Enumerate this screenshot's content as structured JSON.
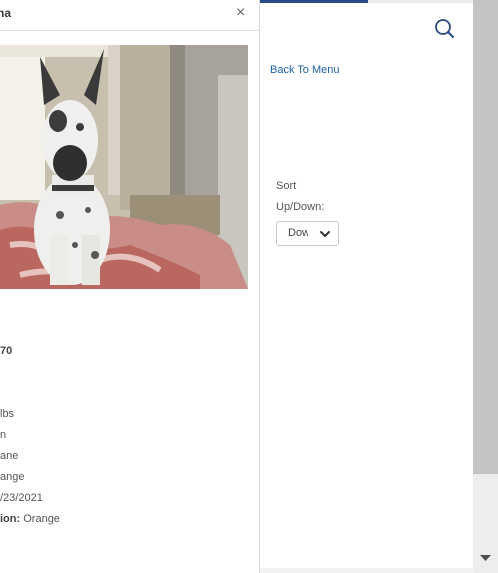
{
  "modal": {
    "title": "na",
    "close_label": "×",
    "photo_alt": "",
    "id_line": "70",
    "details": [
      {
        "label": "",
        "value": "lbs"
      },
      {
        "label": "",
        "value": "n"
      },
      {
        "label": "",
        "value": "ane"
      },
      {
        "label": "",
        "value": "ange"
      },
      {
        "label": "",
        "value": "/23/2021"
      },
      {
        "label": "ion:",
        "value": "Orange"
      }
    ]
  },
  "nav": {
    "back_label": "Back To Menu",
    "search_icon": "search-icon"
  },
  "sort": {
    "label_line1": "Sort",
    "label_line2": "Up/Down:",
    "selected": "Down",
    "chevron_icon": "chevron-down-icon"
  },
  "colors": {
    "accent": "#2a4b86",
    "link": "#1f5fa8",
    "scroll_thumb": "#c4c4c4"
  }
}
